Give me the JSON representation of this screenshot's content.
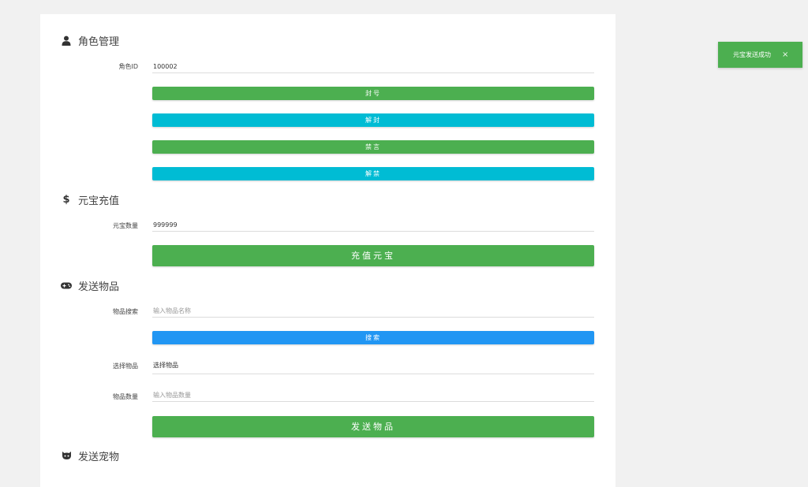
{
  "role": {
    "title": "角色管理",
    "icon": "user-icon",
    "id_label": "角色ID",
    "id_value": "100002",
    "buttons": {
      "ban": "封号",
      "unban": "解封",
      "mute": "禁言",
      "unmute": "解禁"
    }
  },
  "yuanbao": {
    "title": "元宝充值",
    "icon": "dollar-icon",
    "amount_label": "元宝数量",
    "amount_value": "999999",
    "recharge_button": "充值元宝"
  },
  "items": {
    "title": "发送物品",
    "icon": "gamepad-icon",
    "search_label": "物品搜索",
    "search_placeholder": "输入物品名称",
    "search_button": "搜索",
    "select_label": "选择物品",
    "select_value": "选择物品",
    "quantity_label": "物品数量",
    "quantity_placeholder": "输入物品数量",
    "send_button": "发送物品"
  },
  "pets": {
    "title": "发送宠物",
    "icon": "github-cat-icon"
  },
  "toast": {
    "message": "元宝发送成功",
    "close": "×"
  },
  "colors": {
    "green": "#4caf50",
    "cyan": "#00bcd4",
    "blue": "#2196f3"
  }
}
